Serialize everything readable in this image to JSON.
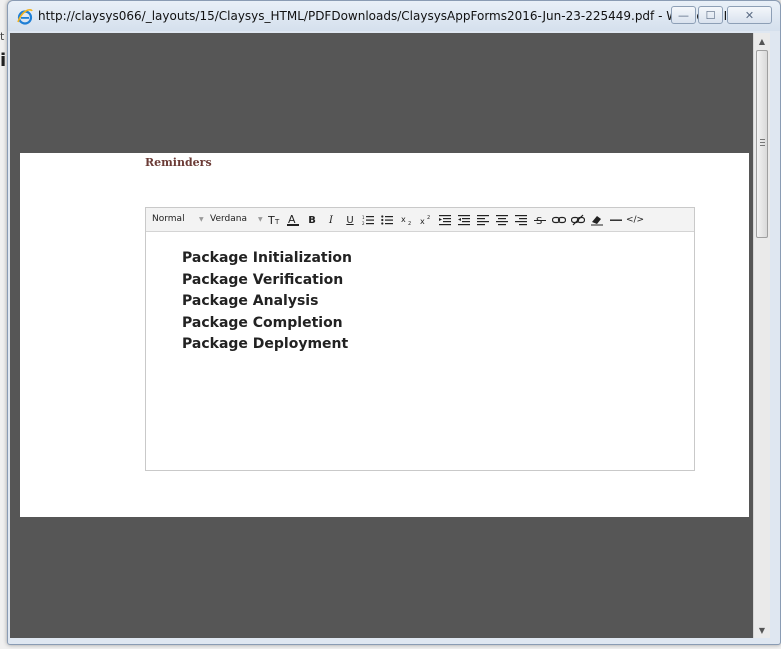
{
  "background": {
    "glyph_top": "t",
    "glyph_mid": "i"
  },
  "window": {
    "title": "http://claysys066/_layouts/15/Claysys_HTML/PDFDownloads/ClaysysAppForms2016-Jun-23-225449.pdf - Windows I...",
    "controls": {
      "minimize": "—",
      "maximize": "☐",
      "close": "✕"
    }
  },
  "document": {
    "section_label": "Reminders",
    "editor": {
      "toolbar": {
        "format_select": "Normal",
        "font_select": "Verdana",
        "icons": [
          "font-size-icon",
          "font-color-icon",
          "bold-icon",
          "italic-icon",
          "underline-icon",
          "ordered-list-icon",
          "unordered-list-icon",
          "subscript-icon",
          "superscript-icon",
          "indent-icon",
          "outdent-icon",
          "align-left-icon",
          "align-center-icon",
          "align-right-icon",
          "strikethrough-icon",
          "link-icon",
          "unlink-icon",
          "eraser-icon",
          "horizontal-rule-icon",
          "source-code-icon"
        ]
      },
      "lines": [
        "Package Initialization",
        "Package Verification",
        "Package Analysis",
        "Package Completion",
        "Package Deployment"
      ]
    }
  },
  "colors": {
    "viewport_bg": "#565656",
    "label_color": "#6b3b36"
  }
}
